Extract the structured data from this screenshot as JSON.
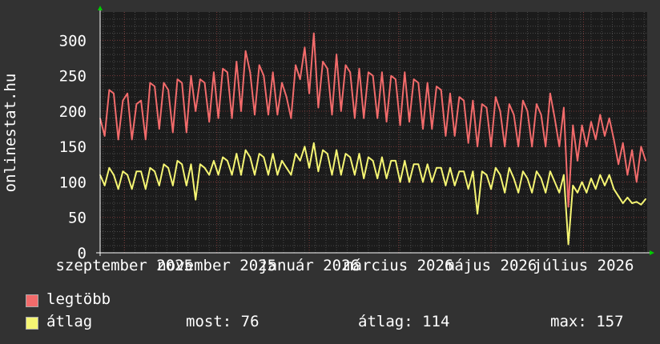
{
  "site_label": "onlinestat.hu",
  "chart_data": {
    "type": "line",
    "ylabel": "onlinestat.hu",
    "ylim": [
      0,
      340
    ],
    "yticks": [
      0,
      50,
      100,
      150,
      200,
      250,
      300
    ],
    "xlim": [
      "2025-08-16",
      "2026-08-12"
    ],
    "xticks": [
      {
        "date": "2025-09-01",
        "label": "szeptember 2025"
      },
      {
        "date": "2025-11-01",
        "label": "november 2025"
      },
      {
        "date": "2026-01-01",
        "label": "január 2026"
      },
      {
        "date": "2026-03-01",
        "label": "március 2026"
      },
      {
        "date": "2026-05-01",
        "label": "május 2026"
      },
      {
        "date": "2026-07-01",
        "label": "július 2026"
      }
    ],
    "grid": true,
    "series": [
      {
        "name": "legtöbb",
        "color": "#f26b6b",
        "points": [
          [
            "2025-08-16",
            190
          ],
          [
            "2025-08-19",
            165
          ],
          [
            "2025-08-22",
            230
          ],
          [
            "2025-08-25",
            225
          ],
          [
            "2025-08-28",
            160
          ],
          [
            "2025-08-31",
            215
          ],
          [
            "2025-09-03",
            225
          ],
          [
            "2025-09-06",
            160
          ],
          [
            "2025-09-09",
            210
          ],
          [
            "2025-09-12",
            215
          ],
          [
            "2025-09-15",
            160
          ],
          [
            "2025-09-18",
            240
          ],
          [
            "2025-09-21",
            235
          ],
          [
            "2025-09-24",
            175
          ],
          [
            "2025-09-27",
            240
          ],
          [
            "2025-09-30",
            230
          ],
          [
            "2025-10-03",
            170
          ],
          [
            "2025-10-06",
            245
          ],
          [
            "2025-10-09",
            240
          ],
          [
            "2025-10-12",
            170
          ],
          [
            "2025-10-15",
            250
          ],
          [
            "2025-10-18",
            200
          ],
          [
            "2025-10-21",
            245
          ],
          [
            "2025-10-24",
            240
          ],
          [
            "2025-10-27",
            185
          ],
          [
            "2025-10-30",
            255
          ],
          [
            "2025-11-02",
            190
          ],
          [
            "2025-11-05",
            260
          ],
          [
            "2025-11-08",
            255
          ],
          [
            "2025-11-11",
            190
          ],
          [
            "2025-11-14",
            270
          ],
          [
            "2025-11-17",
            200
          ],
          [
            "2025-11-20",
            285
          ],
          [
            "2025-11-23",
            255
          ],
          [
            "2025-11-26",
            195
          ],
          [
            "2025-11-29",
            265
          ],
          [
            "2025-12-02",
            250
          ],
          [
            "2025-12-05",
            195
          ],
          [
            "2025-12-08",
            255
          ],
          [
            "2025-12-11",
            195
          ],
          [
            "2025-12-14",
            240
          ],
          [
            "2025-12-17",
            220
          ],
          [
            "2025-12-20",
            190
          ],
          [
            "2025-12-23",
            265
          ],
          [
            "2025-12-26",
            245
          ],
          [
            "2025-12-29",
            290
          ],
          [
            "2026-01-01",
            225
          ],
          [
            "2026-01-04",
            310
          ],
          [
            "2026-01-07",
            205
          ],
          [
            "2026-01-10",
            270
          ],
          [
            "2026-01-13",
            260
          ],
          [
            "2026-01-16",
            195
          ],
          [
            "2026-01-19",
            280
          ],
          [
            "2026-01-22",
            200
          ],
          [
            "2026-01-25",
            265
          ],
          [
            "2026-01-28",
            255
          ],
          [
            "2026-01-31",
            190
          ],
          [
            "2026-02-03",
            260
          ],
          [
            "2026-02-06",
            190
          ],
          [
            "2026-02-09",
            255
          ],
          [
            "2026-02-12",
            250
          ],
          [
            "2026-02-15",
            190
          ],
          [
            "2026-02-18",
            255
          ],
          [
            "2026-02-21",
            185
          ],
          [
            "2026-02-24",
            250
          ],
          [
            "2026-02-27",
            245
          ],
          [
            "2026-03-02",
            180
          ],
          [
            "2026-03-05",
            255
          ],
          [
            "2026-03-08",
            185
          ],
          [
            "2026-03-11",
            245
          ],
          [
            "2026-03-14",
            240
          ],
          [
            "2026-03-17",
            175
          ],
          [
            "2026-03-20",
            240
          ],
          [
            "2026-03-23",
            175
          ],
          [
            "2026-03-26",
            235
          ],
          [
            "2026-03-29",
            230
          ],
          [
            "2026-04-01",
            165
          ],
          [
            "2026-04-04",
            225
          ],
          [
            "2026-04-07",
            165
          ],
          [
            "2026-04-10",
            220
          ],
          [
            "2026-04-13",
            215
          ],
          [
            "2026-04-16",
            155
          ],
          [
            "2026-04-19",
            215
          ],
          [
            "2026-04-22",
            150
          ],
          [
            "2026-04-25",
            210
          ],
          [
            "2026-04-28",
            205
          ],
          [
            "2026-05-01",
            150
          ],
          [
            "2026-05-04",
            220
          ],
          [
            "2026-05-07",
            200
          ],
          [
            "2026-05-10",
            150
          ],
          [
            "2026-05-13",
            210
          ],
          [
            "2026-05-16",
            195
          ],
          [
            "2026-05-19",
            150
          ],
          [
            "2026-05-22",
            215
          ],
          [
            "2026-05-25",
            200
          ],
          [
            "2026-05-28",
            150
          ],
          [
            "2026-05-31",
            210
          ],
          [
            "2026-06-03",
            195
          ],
          [
            "2026-06-06",
            150
          ],
          [
            "2026-06-09",
            225
          ],
          [
            "2026-06-12",
            190
          ],
          [
            "2026-06-15",
            150
          ],
          [
            "2026-06-18",
            205
          ],
          [
            "2026-06-21",
            65
          ],
          [
            "2026-06-24",
            180
          ],
          [
            "2026-06-27",
            130
          ],
          [
            "2026-06-30",
            180
          ],
          [
            "2026-07-03",
            150
          ],
          [
            "2026-07-06",
            185
          ],
          [
            "2026-07-09",
            160
          ],
          [
            "2026-07-12",
            195
          ],
          [
            "2026-07-15",
            165
          ],
          [
            "2026-07-18",
            190
          ],
          [
            "2026-07-21",
            160
          ],
          [
            "2026-07-24",
            125
          ],
          [
            "2026-07-27",
            155
          ],
          [
            "2026-07-30",
            110
          ],
          [
            "2026-08-02",
            145
          ],
          [
            "2026-08-05",
            100
          ],
          [
            "2026-08-08",
            150
          ],
          [
            "2026-08-11",
            130
          ]
        ]
      },
      {
        "name": "átlag",
        "color": "#f5f573",
        "points": [
          [
            "2025-08-16",
            110
          ],
          [
            "2025-08-19",
            95
          ],
          [
            "2025-08-22",
            120
          ],
          [
            "2025-08-25",
            110
          ],
          [
            "2025-08-28",
            90
          ],
          [
            "2025-08-31",
            115
          ],
          [
            "2025-09-03",
            110
          ],
          [
            "2025-09-06",
            90
          ],
          [
            "2025-09-09",
            115
          ],
          [
            "2025-09-12",
            115
          ],
          [
            "2025-09-15",
            90
          ],
          [
            "2025-09-18",
            120
          ],
          [
            "2025-09-21",
            115
          ],
          [
            "2025-09-24",
            95
          ],
          [
            "2025-09-27",
            125
          ],
          [
            "2025-09-30",
            120
          ],
          [
            "2025-10-03",
            95
          ],
          [
            "2025-10-06",
            130
          ],
          [
            "2025-10-09",
            125
          ],
          [
            "2025-10-12",
            95
          ],
          [
            "2025-10-15",
            125
          ],
          [
            "2025-10-18",
            75
          ],
          [
            "2025-10-21",
            125
          ],
          [
            "2025-10-24",
            120
          ],
          [
            "2025-10-27",
            110
          ],
          [
            "2025-10-30",
            130
          ],
          [
            "2025-11-02",
            110
          ],
          [
            "2025-11-05",
            135
          ],
          [
            "2025-11-08",
            130
          ],
          [
            "2025-11-11",
            110
          ],
          [
            "2025-11-14",
            140
          ],
          [
            "2025-11-17",
            110
          ],
          [
            "2025-11-20",
            145
          ],
          [
            "2025-11-23",
            135
          ],
          [
            "2025-11-26",
            110
          ],
          [
            "2025-11-29",
            140
          ],
          [
            "2025-12-02",
            135
          ],
          [
            "2025-12-05",
            110
          ],
          [
            "2025-12-08",
            140
          ],
          [
            "2025-12-11",
            110
          ],
          [
            "2025-12-14",
            130
          ],
          [
            "2025-12-17",
            120
          ],
          [
            "2025-12-20",
            110
          ],
          [
            "2025-12-23",
            140
          ],
          [
            "2025-12-26",
            130
          ],
          [
            "2025-12-29",
            150
          ],
          [
            "2026-01-01",
            120
          ],
          [
            "2026-01-04",
            155
          ],
          [
            "2026-01-07",
            115
          ],
          [
            "2026-01-10",
            145
          ],
          [
            "2026-01-13",
            140
          ],
          [
            "2026-01-16",
            110
          ],
          [
            "2026-01-19",
            145
          ],
          [
            "2026-01-22",
            110
          ],
          [
            "2026-01-25",
            140
          ],
          [
            "2026-01-28",
            135
          ],
          [
            "2026-01-31",
            110
          ],
          [
            "2026-02-03",
            140
          ],
          [
            "2026-02-06",
            105
          ],
          [
            "2026-02-09",
            135
          ],
          [
            "2026-02-12",
            130
          ],
          [
            "2026-02-15",
            105
          ],
          [
            "2026-02-18",
            135
          ],
          [
            "2026-02-21",
            105
          ],
          [
            "2026-02-24",
            130
          ],
          [
            "2026-02-27",
            130
          ],
          [
            "2026-03-02",
            100
          ],
          [
            "2026-03-05",
            130
          ],
          [
            "2026-03-08",
            100
          ],
          [
            "2026-03-11",
            125
          ],
          [
            "2026-03-14",
            125
          ],
          [
            "2026-03-17",
            100
          ],
          [
            "2026-03-20",
            125
          ],
          [
            "2026-03-23",
            100
          ],
          [
            "2026-03-26",
            120
          ],
          [
            "2026-03-29",
            120
          ],
          [
            "2026-04-01",
            95
          ],
          [
            "2026-04-04",
            120
          ],
          [
            "2026-04-07",
            95
          ],
          [
            "2026-04-10",
            115
          ],
          [
            "2026-04-13",
            115
          ],
          [
            "2026-04-16",
            90
          ],
          [
            "2026-04-19",
            115
          ],
          [
            "2026-04-22",
            55
          ],
          [
            "2026-04-25",
            115
          ],
          [
            "2026-04-28",
            110
          ],
          [
            "2026-05-01",
            90
          ],
          [
            "2026-05-04",
            120
          ],
          [
            "2026-05-07",
            110
          ],
          [
            "2026-05-10",
            85
          ],
          [
            "2026-05-13",
            120
          ],
          [
            "2026-05-16",
            105
          ],
          [
            "2026-05-19",
            85
          ],
          [
            "2026-05-22",
            115
          ],
          [
            "2026-05-25",
            105
          ],
          [
            "2026-05-28",
            85
          ],
          [
            "2026-05-31",
            115
          ],
          [
            "2026-06-03",
            105
          ],
          [
            "2026-06-06",
            85
          ],
          [
            "2026-06-09",
            115
          ],
          [
            "2026-06-12",
            100
          ],
          [
            "2026-06-15",
            85
          ],
          [
            "2026-06-18",
            110
          ],
          [
            "2026-06-21",
            12
          ],
          [
            "2026-06-24",
            95
          ],
          [
            "2026-06-27",
            85
          ],
          [
            "2026-06-30",
            100
          ],
          [
            "2026-07-03",
            85
          ],
          [
            "2026-07-06",
            105
          ],
          [
            "2026-07-09",
            90
          ],
          [
            "2026-07-12",
            110
          ],
          [
            "2026-07-15",
            95
          ],
          [
            "2026-07-18",
            110
          ],
          [
            "2026-07-21",
            90
          ],
          [
            "2026-07-24",
            80
          ],
          [
            "2026-07-27",
            70
          ],
          [
            "2026-07-30",
            78
          ],
          [
            "2026-08-02",
            70
          ],
          [
            "2026-08-05",
            72
          ],
          [
            "2026-08-08",
            68
          ],
          [
            "2026-08-11",
            76
          ]
        ]
      }
    ]
  },
  "legend": {
    "items": [
      {
        "label": "legtöbb",
        "color": "#f26b6b"
      },
      {
        "label": "átlag",
        "color": "#f5f573"
      }
    ],
    "stats": {
      "most": "most: 76",
      "atlag": "átlag: 114",
      "max": "max: 157"
    }
  }
}
